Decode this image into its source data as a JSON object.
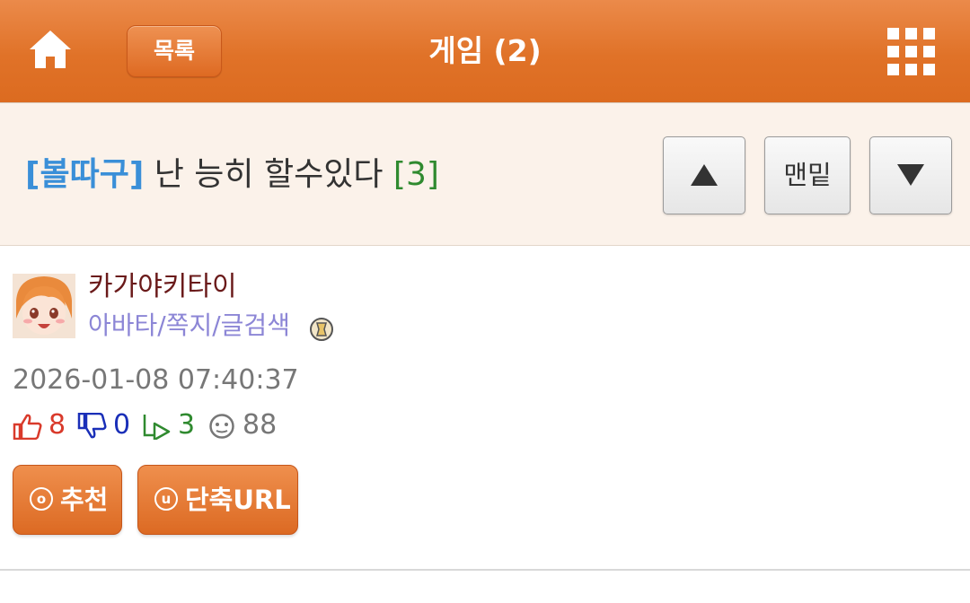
{
  "header": {
    "home_icon": "home-icon",
    "list_label": "목록",
    "title": "게임 (2)",
    "menu_icon": "grid-menu-icon",
    "accent_color": "#e07228"
  },
  "post": {
    "category": "[볼따구]",
    "title": "난 능히 할수있다",
    "comment_count": "[3]"
  },
  "nav": {
    "up_icon": "arrow-up-icon",
    "bottom_label": "맨밑",
    "down_icon": "arrow-down-icon"
  },
  "author": {
    "name": "카가야키타이",
    "links": "아바타/쪽지/글검색",
    "badge_icon": "badge-icon",
    "avatar": "anime-girl-avatar"
  },
  "date": "2026-01-08 07:40:37",
  "stats": {
    "likes": "8",
    "dislikes": "0",
    "replies": "3",
    "views": "88",
    "like_color": "#d93a2b",
    "dislike_color": "#1a2fb8",
    "reply_color": "#2f8a2f",
    "view_color": "#777777"
  },
  "actions": {
    "recommend_label": "추천",
    "recommend_glyph": "o",
    "shorturl_label": "단축URL",
    "shorturl_glyph": "u"
  }
}
